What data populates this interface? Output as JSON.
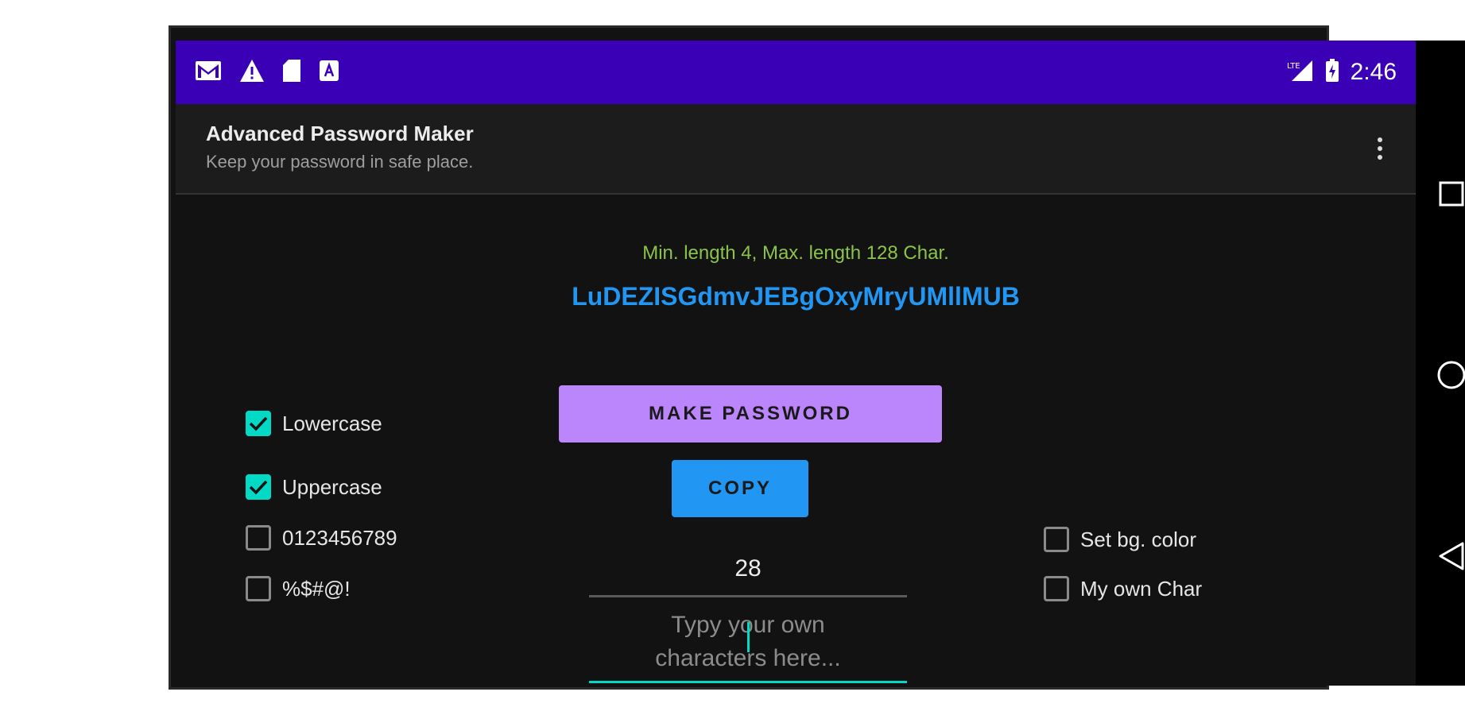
{
  "status_bar": {
    "time": "2:46",
    "left_icons": [
      "gmail-icon",
      "warning-icon",
      "sd-card-icon",
      "font-icon"
    ],
    "right_icons": [
      "lte-signal-icon",
      "battery-charging-icon"
    ]
  },
  "app_bar": {
    "title": "Advanced Password Maker",
    "subtitle": "Keep your password in safe place."
  },
  "main": {
    "hint": "Min. length 4, Max. length 128 Char.",
    "password": "LuDEZISGdmvJEBgOxyMryUMllMUB",
    "make_button": "MAKE PASSWORD",
    "copy_button": "COPY",
    "length_value": "28",
    "own_chars_placeholder_line1": "Typy your own",
    "own_chars_placeholder_line2": "characters here..."
  },
  "options_left": [
    {
      "label": "Lowercase",
      "checked": true
    },
    {
      "label": "Uppercase",
      "checked": true
    },
    {
      "label": "0123456789",
      "checked": false
    },
    {
      "label": "%$#@!",
      "checked": false
    }
  ],
  "options_right": [
    {
      "label": "Set bg. color",
      "checked": false
    },
    {
      "label": "My own Char",
      "checked": false
    }
  ],
  "colors": {
    "status_bar": "#3a00b5",
    "hint": "#8bc34a",
    "password": "#2196f3",
    "make_button": "#bb86fc",
    "copy_button": "#2196f3",
    "accent": "#03dac5"
  }
}
